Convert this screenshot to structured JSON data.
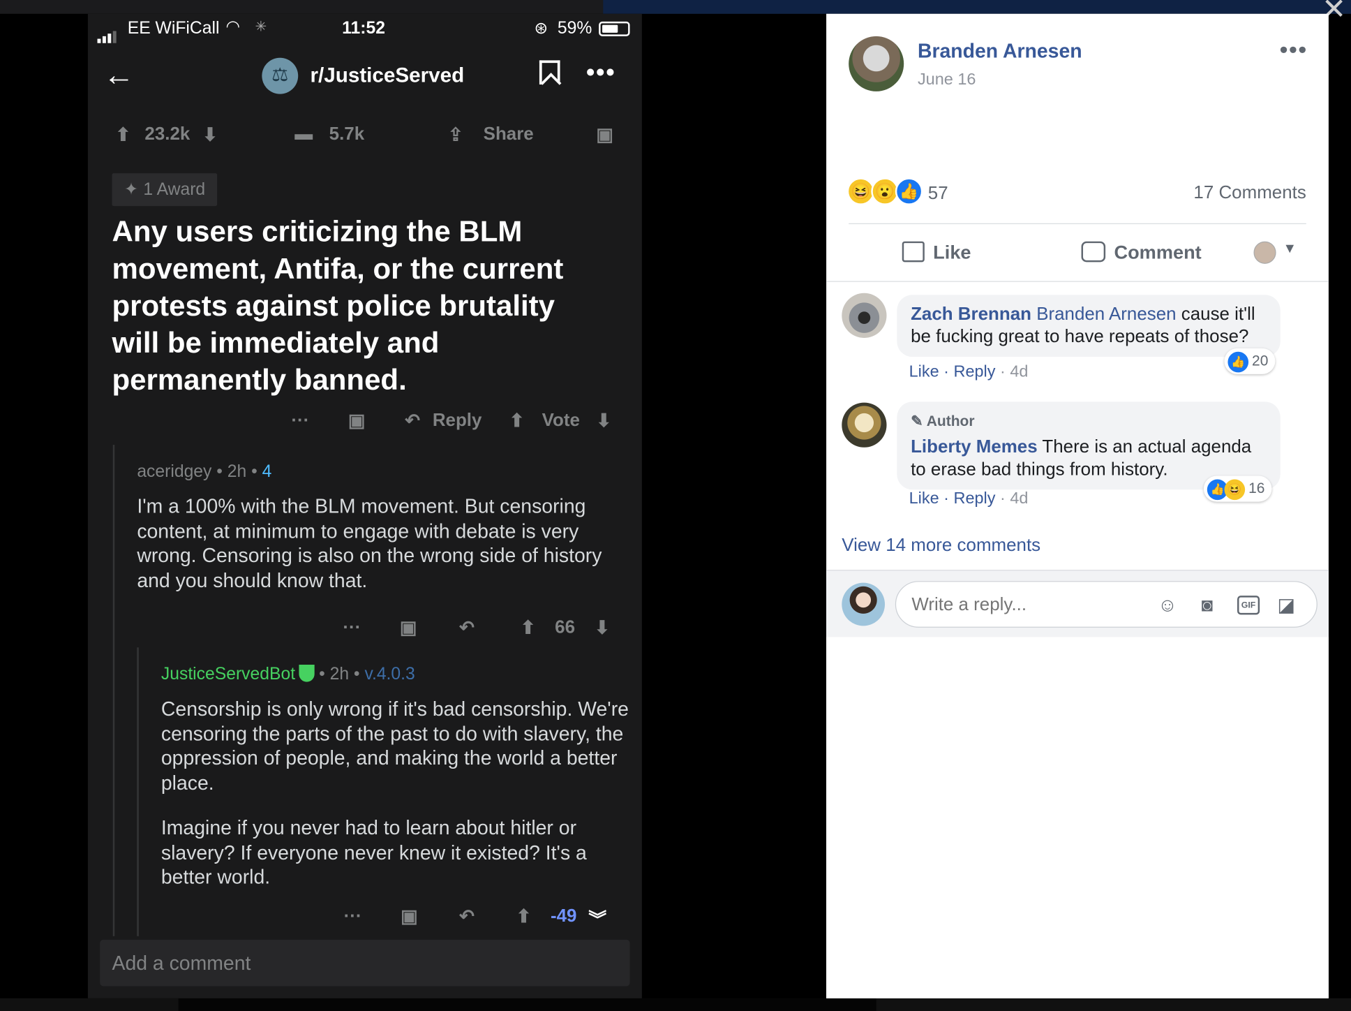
{
  "phone": {
    "status": {
      "carrier": "EE WiFiCall",
      "time": "11:52",
      "battery": "59%"
    },
    "nav": {
      "subreddit": "r/JusticeServed"
    },
    "post": {
      "upvotes": "23.2k",
      "comments": "5.7k",
      "share_label": "Share",
      "award": "1 Award",
      "title": "Any users criticizing the BLM movement, Antifa, or the current protests against police brutality will be immediately and permanently banned.",
      "reply_label": "Reply",
      "vote_label": "Vote"
    },
    "comment1": {
      "user": "aceridgey",
      "age": "2h",
      "score_small": "4",
      "body": "I'm a 100% with the BLM movement. But censoring content, at minimum to engage with debate is very wrong. Censoring is also on the wrong side of history and you should know that.",
      "votes": "66"
    },
    "comment2": {
      "user": "JusticeServedBot",
      "age": "2h",
      "version": "v.4.0.3",
      "body1": "Censorship is only wrong if it's bad censorship. We're censoring the parts of the past to do with slavery, the oppression of people, and making the world a better place.",
      "body2": "Imagine if you never had to learn about hitler or slavery? If everyone never knew it existed? It's a better world.",
      "votes": "-49"
    },
    "add_comment_placeholder": "Add a comment"
  },
  "fb": {
    "author": "Branden Arnesen",
    "date": "June 16",
    "reaction_count": "57",
    "comment_count": "17 Comments",
    "like_label": "Like",
    "comment_label": "Comment",
    "comments": [
      {
        "name": "Zach Brennan",
        "tag": "Branden Arnesen",
        "text": " cause it'll be fucking great to have repeats of those?",
        "like": "Like",
        "reply": "Reply",
        "time": "4d",
        "reactions": "20"
      },
      {
        "badge": "Author",
        "name": "Liberty Memes",
        "text": " There is an actual agenda to erase bad things from history.",
        "like": "Like",
        "reply": "Reply",
        "time": "4d",
        "reactions": "16"
      }
    ],
    "view_more": "View 14 more comments",
    "reply_placeholder": "Write a reply..."
  },
  "colors": {
    "reddit_bg": "#1a1a1b",
    "fb_link": "#385898",
    "bot_green": "#46d160"
  }
}
